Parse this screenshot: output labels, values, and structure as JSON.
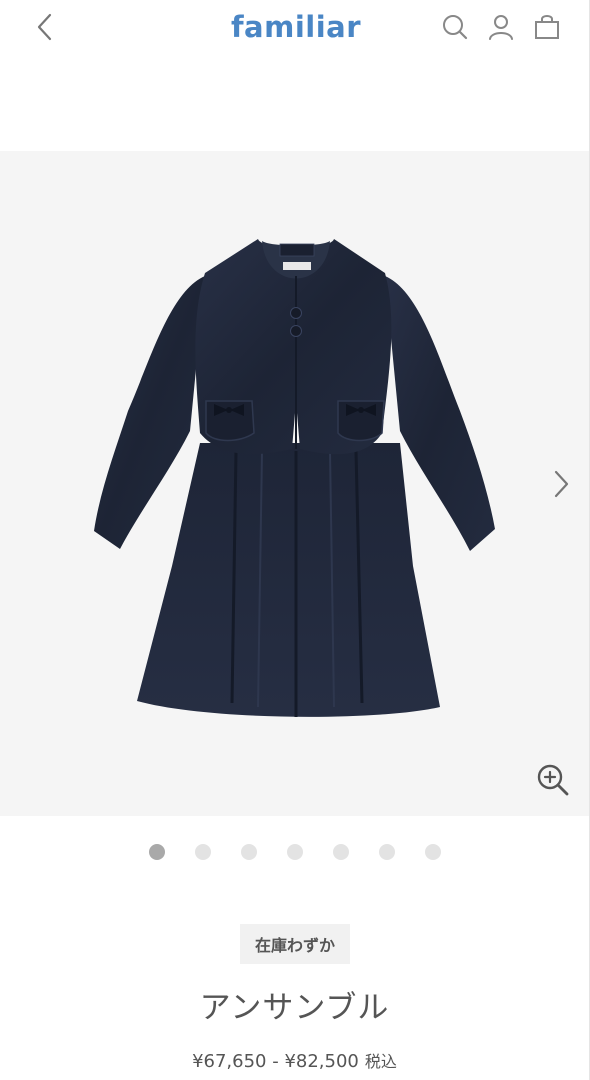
{
  "header": {
    "logo": "familiar",
    "back_icon": "chevron-left-icon",
    "search_icon": "search-icon",
    "account_icon": "user-icon",
    "cart_icon": "shopping-bag-icon"
  },
  "gallery": {
    "image_alt": "navy ensemble jacket and dress",
    "next_icon": "chevron-right-icon",
    "zoom_icon": "zoom-in-icon",
    "dots_count": 7,
    "active_dot": 1
  },
  "product": {
    "stock_badge": "在庫わずか",
    "title": "アンサンブル",
    "price_range": "¥67,650 - ¥82,500",
    "tax_label": "税込"
  },
  "colors": {
    "brand": "#4a86c5",
    "garment": "#1f2638",
    "bg_gallery": "#f5f5f5"
  }
}
